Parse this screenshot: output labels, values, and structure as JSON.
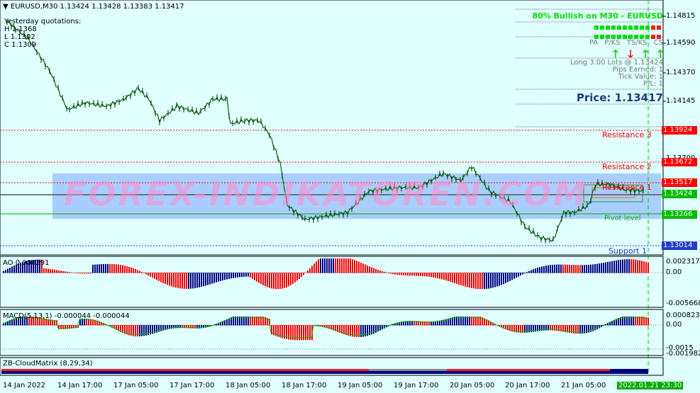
{
  "header": {
    "symbol_line": "EURUSD,M30  1.13424 1.13428 1.13383 1.13417",
    "yq_title": "Yesterday quotations:",
    "yq_high": "H 1.1368",
    "yq_low": "L 1.1302",
    "yq_close": "C 1.1309"
  },
  "dashboard": {
    "bullish_text": "80% Bullish on M30 - EURUSD",
    "headers": "PA P/KS TS/KS CS",
    "lots": "Long 3.00 Lots @ 1.13424",
    "pips": "Pips Earned: 1",
    "tick": "Tick Value: 1",
    "pl": "P/L: 1",
    "price": "Price: 1.13417",
    "arrow_up": "🡑",
    "arrow_down": "🡓",
    "up_color": "#00cc00",
    "down_color": "#ff0000"
  },
  "levels": {
    "r3": "Resistance 3",
    "r2": "Resistance 2",
    "r1": "Resistance 1",
    "pivot": "Pivot level",
    "s1": "Support 1",
    "r3_price": "1.13924",
    "r2_price": "1.13672",
    "r1_price": "1.13517",
    "cur_price": "1.13424",
    "pivot_price": "1.13266",
    "s1_price": "1.13014"
  },
  "price_axis": [
    "1.14815",
    "1.14590",
    "1.14370",
    "1.14145",
    "1.13700"
  ],
  "watermark": "FOREX-INDIKATOREN.COM",
  "ao": {
    "label": "AO 0.000291",
    "axis": [
      "0.002317",
      "0.00",
      "-0.005668"
    ]
  },
  "macd": {
    "label": "MACD(5,13,1) -0.000044 -0.000044",
    "axis": [
      "0.000823",
      "0.00",
      "-0.0015",
      "-0.001982"
    ]
  },
  "cloud": {
    "label": "ZB-CloudMatrix (8,29,34)"
  },
  "time_axis": [
    "14 Jan 2022",
    "14 Jan 17:00",
    "17 Jan 05:00",
    "17 Jan 17:00",
    "18 Jan 05:00",
    "18 Jan 17:00",
    "19 Jan 05:00",
    "19 Jan 17:00",
    "20 Jan 05:00",
    "20 Jan 17:00",
    "21 Jan 05:00"
  ],
  "time_current": "2022.01.21 23:30",
  "colors": {
    "bg": "#e0ffff",
    "resistance": "#ff0000",
    "pivot": "#00aa00",
    "support": "#1f3ecc",
    "band": "#7aa5ff",
    "ao_up": "#000080",
    "ao_down": "#ff0000"
  }
}
